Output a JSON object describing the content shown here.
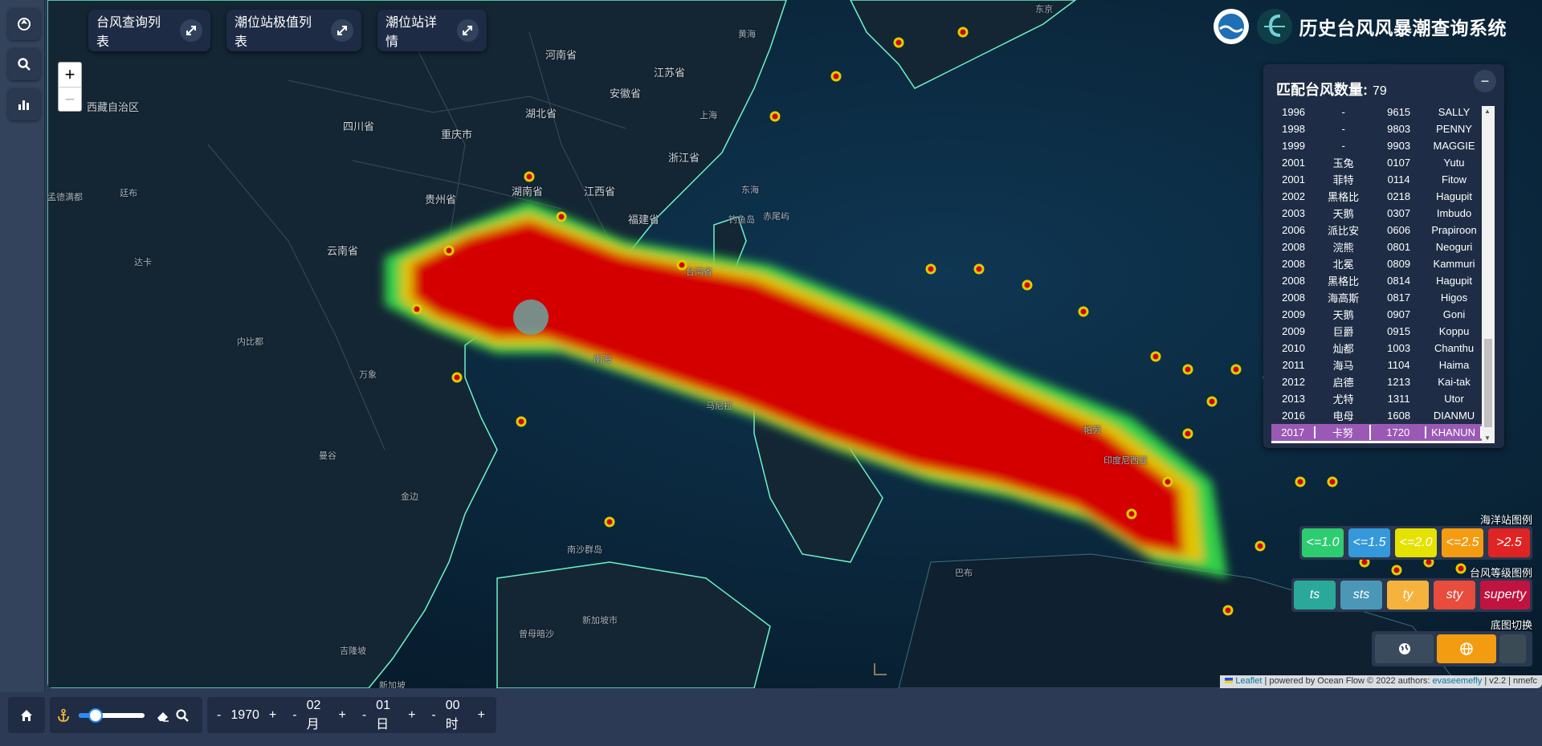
{
  "app": {
    "title": "历史台风风暴潮查询系统"
  },
  "top_buttons": [
    {
      "label": "台风查询列表"
    },
    {
      "label": "潮位站极值列表"
    },
    {
      "label": "潮位站详情"
    }
  ],
  "map_labels": [
    {
      "text": "河南省"
    },
    {
      "text": "江苏省"
    },
    {
      "text": "安徽省"
    },
    {
      "text": "湖北省"
    },
    {
      "text": "四川省"
    },
    {
      "text": "重庆市"
    },
    {
      "text": "浙江省"
    },
    {
      "text": "湖南省"
    },
    {
      "text": "江西省"
    },
    {
      "text": "贵州省"
    },
    {
      "text": "福建省"
    },
    {
      "text": "云南省"
    },
    {
      "text": "台湾省"
    },
    {
      "text": "东海"
    },
    {
      "text": "黄海"
    },
    {
      "text": "钓鱼岛"
    },
    {
      "text": "赤尾屿"
    },
    {
      "text": "西藏自治区"
    },
    {
      "text": "孟德满都"
    },
    {
      "text": "廷布"
    },
    {
      "text": "内比都"
    },
    {
      "text": "曼谷"
    },
    {
      "text": "金边"
    },
    {
      "text": "吉隆坡"
    },
    {
      "text": "南沙群岛"
    },
    {
      "text": "新加坡"
    },
    {
      "text": "曾母暗沙"
    },
    {
      "text": "新加坡市"
    },
    {
      "text": "马尼拉"
    },
    {
      "text": "帕劳"
    },
    {
      "text": "印度尼西亚"
    },
    {
      "text": "巴布"
    },
    {
      "text": "东京"
    },
    {
      "text": "上海"
    },
    {
      "text": "南海"
    },
    {
      "text": "达卡"
    },
    {
      "text": "万象"
    }
  ],
  "typhoon_list": {
    "header_label": "匹配台风数量:",
    "count": "79",
    "collapse_icon": "minus-icon",
    "rows": [
      {
        "year": "1996",
        "cn": "-",
        "code": "9615",
        "en": "SALLY"
      },
      {
        "year": "1998",
        "cn": "-",
        "code": "9803",
        "en": "PENNY"
      },
      {
        "year": "1999",
        "cn": "-",
        "code": "9903",
        "en": "MAGGIE"
      },
      {
        "year": "2001",
        "cn": "玉兔",
        "code": "0107",
        "en": "Yutu"
      },
      {
        "year": "2001",
        "cn": "菲特",
        "code": "0114",
        "en": "Fitow"
      },
      {
        "year": "2002",
        "cn": "黑格比",
        "code": "0218",
        "en": "Hagupit"
      },
      {
        "year": "2003",
        "cn": "天鹅",
        "code": "0307",
        "en": "Imbudo"
      },
      {
        "year": "2006",
        "cn": "派比安",
        "code": "0606",
        "en": "Prapiroon"
      },
      {
        "year": "2008",
        "cn": "浣熊",
        "code": "0801",
        "en": "Neoguri"
      },
      {
        "year": "2008",
        "cn": "北冕",
        "code": "0809",
        "en": "Kammuri"
      },
      {
        "year": "2008",
        "cn": "黑格比",
        "code": "0814",
        "en": "Hagupit"
      },
      {
        "year": "2008",
        "cn": "海高斯",
        "code": "0817",
        "en": "Higos"
      },
      {
        "year": "2009",
        "cn": "天鹅",
        "code": "0907",
        "en": "Goni"
      },
      {
        "year": "2009",
        "cn": "巨爵",
        "code": "0915",
        "en": "Koppu"
      },
      {
        "year": "2010",
        "cn": "灿都",
        "code": "1003",
        "en": "Chanthu"
      },
      {
        "year": "2011",
        "cn": "海马",
        "code": "1104",
        "en": "Haima"
      },
      {
        "year": "2012",
        "cn": "启德",
        "code": "1213",
        "en": "Kai-tak"
      },
      {
        "year": "2013",
        "cn": "尤特",
        "code": "1311",
        "en": "Utor"
      },
      {
        "year": "2016",
        "cn": "电母",
        "code": "1608",
        "en": "DIANMU"
      },
      {
        "year": "2017",
        "cn": "卡努",
        "code": "1720",
        "en": "KHANUN"
      }
    ],
    "selected_index": 19
  },
  "ocean_station_legend": {
    "title": "海洋站图例",
    "items": [
      {
        "label": "<=1.0",
        "color": "#2ecc71"
      },
      {
        "label": "<=1.5",
        "color": "#3498db"
      },
      {
        "label": "<=2.0",
        "color": "#e6e200"
      },
      {
        "label": "<=2.5",
        "color": "#f39c12"
      },
      {
        "label": ">2.5",
        "color": "#e02424"
      }
    ]
  },
  "typhoon_level_legend": {
    "title": "台风等级图例",
    "items": [
      {
        "label": "ts",
        "color": "#2aa89a"
      },
      {
        "label": "sts",
        "color": "#4a97b8"
      },
      {
        "label": "ty",
        "color": "#f5b33d"
      },
      {
        "label": "sty",
        "color": "#e74c3c"
      },
      {
        "label": "superty",
        "color": "#c0133f"
      }
    ]
  },
  "basemap_switch": {
    "title": "底图切换",
    "options": [
      {
        "icon": "globe-dark-icon",
        "color": "#2a3850"
      },
      {
        "icon": "globe-icon",
        "color": "#f39c12"
      },
      {
        "icon": "blank-icon",
        "color": "#3a4b56"
      }
    ]
  },
  "attribution": {
    "leaflet": "Leaflet",
    "text": " | powered by Ocean Flow © 2022 authors: ",
    "author": "evaseemefly",
    "version": " | v2.2 | nmefc"
  },
  "time_controls": {
    "year": "1970",
    "month": "02月",
    "day": "01日",
    "hour": "00时",
    "plus": "+",
    "minus": "-",
    "slider_fraction": 0.25
  },
  "colors": {
    "panel": "#1e2d45",
    "selected_row": "#9b59b6",
    "heatmap": "#d40000"
  }
}
